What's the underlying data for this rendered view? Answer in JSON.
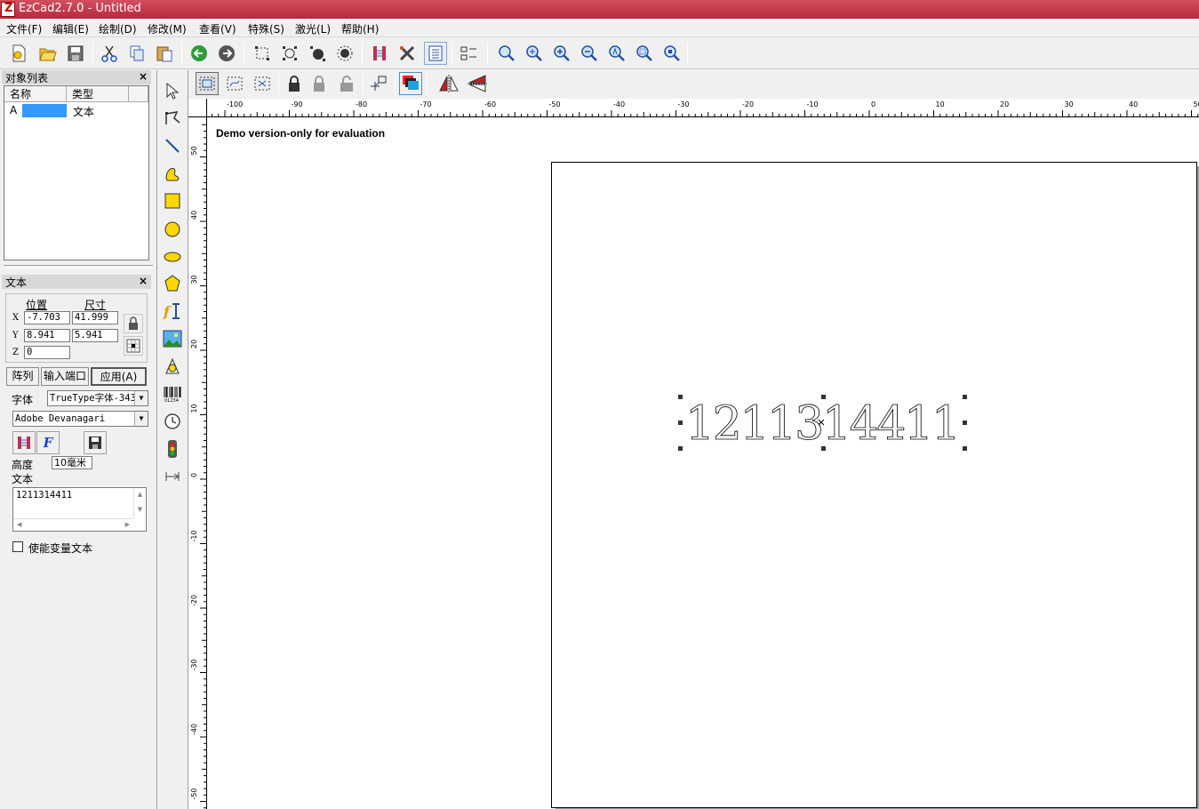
{
  "window": {
    "title": "EzCad2.7.0 - Untitled"
  },
  "menu": [
    "文件(F)",
    "编辑(E)",
    "绘制(D)",
    "修改(M)",
    "查看(V)",
    "特殊(S)",
    "激光(L)",
    "帮助(H)"
  ],
  "object_list": {
    "title": "对象列表",
    "close": "×",
    "col_name": "名称",
    "col_type": "类型",
    "row_name": "A",
    "row_type": "文本"
  },
  "props": {
    "title": "文本",
    "close": "×",
    "pos_label": "位置",
    "size_label": "尺寸",
    "x_label": "X",
    "y_label": "Y",
    "z_label": "Z",
    "x": "-7.703",
    "y": "8.941",
    "z": "0",
    "w": "41.999",
    "h": "5.941",
    "array_btn": "阵列",
    "input_port_btn": "输入端口",
    "apply_btn": "应用(A)",
    "font_label": "字体",
    "font_type": "TrueType字体-343",
    "font_name": "Adobe Devanagari",
    "height_label": "高度",
    "height_value": "10毫米",
    "text_label": "文本",
    "text_value": "1211314411",
    "variable_text": "使能变量文本"
  },
  "canvas": {
    "watermark": "Demo version-only for evaluation",
    "object_text": "1211314411"
  },
  "ruler_h": [
    "-100",
    "-90",
    "-80",
    "-70",
    "-60",
    "-50",
    "-40",
    "-30",
    "-20",
    "-10",
    "0",
    "10",
    "20",
    "30",
    "40",
    "50"
  ],
  "ruler_v": [
    "50",
    "40",
    "30",
    "20",
    "10",
    "0",
    "-10",
    "-20",
    "-30",
    "-40",
    "-50"
  ],
  "colors": {
    "title_bar": "#c03848",
    "selection": "#3399ff",
    "tool_yellow": "#ffd700"
  }
}
